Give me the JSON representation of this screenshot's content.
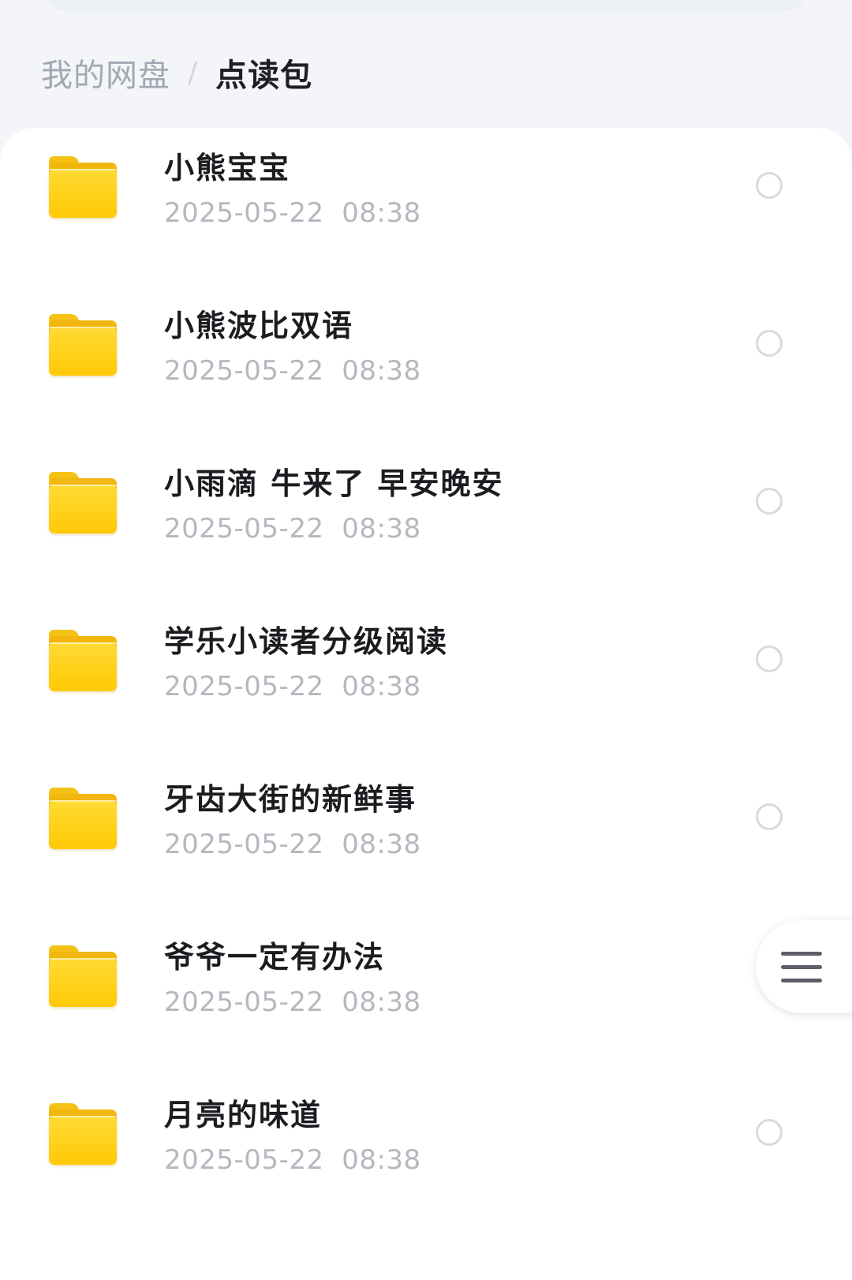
{
  "breadcrumb": {
    "parent": "我的网盘",
    "separator": "/",
    "current": "点读包"
  },
  "folders": [
    {
      "name": "小熊宝宝",
      "date": "2025-05-22  08:38"
    },
    {
      "name": "小熊波比双语",
      "date": "2025-05-22  08:38"
    },
    {
      "name": "小雨滴 牛来了 早安晚安",
      "date": "2025-05-22  08:38"
    },
    {
      "name": "学乐小读者分级阅读",
      "date": "2025-05-22  08:38"
    },
    {
      "name": "牙齿大街的新鲜事",
      "date": "2025-05-22  08:38"
    },
    {
      "name": "爷爷一定有办法",
      "date": "2025-05-22  08:38"
    },
    {
      "name": "月亮的味道",
      "date": "2025-05-22  08:38"
    }
  ],
  "icons": {
    "folder": "folder-icon",
    "select": "radio-circle",
    "menu": "hamburger-menu-icon"
  },
  "colors": {
    "folder": "#ffcc0e",
    "name_text": "#1a1c20",
    "date_text": "#b4b8bf",
    "breadcrumb_parent": "#a2a8b2"
  }
}
